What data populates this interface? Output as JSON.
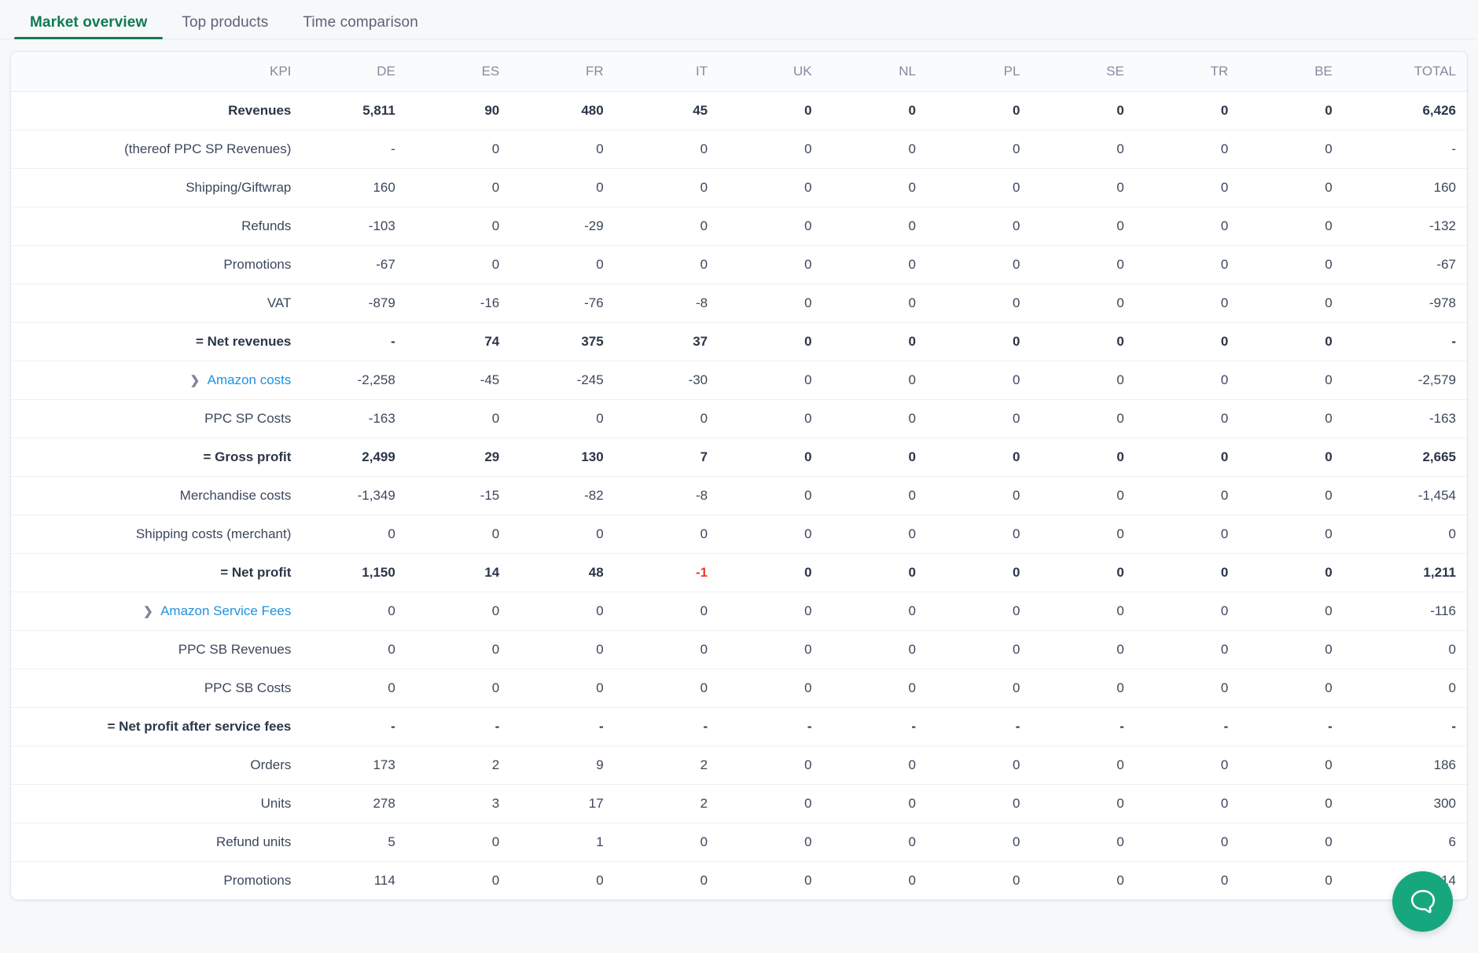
{
  "tabs": [
    {
      "label": "Market overview",
      "active": true
    },
    {
      "label": "Top products",
      "active": false
    },
    {
      "label": "Time comparison",
      "active": false
    }
  ],
  "table": {
    "columns": [
      "KPI",
      "DE",
      "ES",
      "FR",
      "IT",
      "UK",
      "NL",
      "PL",
      "SE",
      "TR",
      "BE",
      "TOTAL"
    ],
    "rows": [
      {
        "label": "Revenues",
        "bold": true,
        "expandable": false,
        "link": false,
        "values": [
          "5,811",
          "90",
          "480",
          "45",
          "0",
          "0",
          "0",
          "0",
          "0",
          "0",
          "6,426"
        ]
      },
      {
        "label": "(thereof PPC SP Revenues)",
        "bold": false,
        "expandable": false,
        "link": false,
        "values": [
          "-",
          "0",
          "0",
          "0",
          "0",
          "0",
          "0",
          "0",
          "0",
          "0",
          "-"
        ]
      },
      {
        "label": "Shipping/Giftwrap",
        "bold": false,
        "expandable": false,
        "link": false,
        "values": [
          "160",
          "0",
          "0",
          "0",
          "0",
          "0",
          "0",
          "0",
          "0",
          "0",
          "160"
        ]
      },
      {
        "label": "Refunds",
        "bold": false,
        "expandable": false,
        "link": false,
        "values": [
          "-103",
          "0",
          "-29",
          "0",
          "0",
          "0",
          "0",
          "0",
          "0",
          "0",
          "-132"
        ]
      },
      {
        "label": "Promotions",
        "bold": false,
        "expandable": false,
        "link": false,
        "values": [
          "-67",
          "0",
          "0",
          "0",
          "0",
          "0",
          "0",
          "0",
          "0",
          "0",
          "-67"
        ]
      },
      {
        "label": "VAT",
        "bold": false,
        "expandable": false,
        "link": false,
        "values": [
          "-879",
          "-16",
          "-76",
          "-8",
          "0",
          "0",
          "0",
          "0",
          "0",
          "0",
          "-978"
        ]
      },
      {
        "label": "= Net revenues",
        "bold": true,
        "expandable": false,
        "link": false,
        "values": [
          "-",
          "74",
          "375",
          "37",
          "0",
          "0",
          "0",
          "0",
          "0",
          "0",
          "-"
        ]
      },
      {
        "label": "Amazon costs",
        "bold": false,
        "expandable": true,
        "link": true,
        "values": [
          "-2,258",
          "-45",
          "-245",
          "-30",
          "0",
          "0",
          "0",
          "0",
          "0",
          "0",
          "-2,579"
        ]
      },
      {
        "label": "PPC SP Costs",
        "bold": false,
        "expandable": false,
        "link": false,
        "values": [
          "-163",
          "0",
          "0",
          "0",
          "0",
          "0",
          "0",
          "0",
          "0",
          "0",
          "-163"
        ]
      },
      {
        "label": "= Gross profit",
        "bold": true,
        "expandable": false,
        "link": false,
        "values": [
          "2,499",
          "29",
          "130",
          "7",
          "0",
          "0",
          "0",
          "0",
          "0",
          "0",
          "2,665"
        ]
      },
      {
        "label": "Merchandise costs",
        "bold": false,
        "expandable": false,
        "link": false,
        "values": [
          "-1,349",
          "-15",
          "-82",
          "-8",
          "0",
          "0",
          "0",
          "0",
          "0",
          "0",
          "-1,454"
        ]
      },
      {
        "label": "Shipping costs (merchant)",
        "bold": false,
        "expandable": false,
        "link": false,
        "values": [
          "0",
          "0",
          "0",
          "0",
          "0",
          "0",
          "0",
          "0",
          "0",
          "0",
          "0"
        ]
      },
      {
        "label": "= Net profit",
        "bold": true,
        "expandable": false,
        "link": false,
        "values": [
          "1,150",
          "14",
          "48",
          "-1",
          "0",
          "0",
          "0",
          "0",
          "0",
          "0",
          "1,211"
        ]
      },
      {
        "label": "Amazon Service Fees",
        "bold": false,
        "expandable": true,
        "link": true,
        "values": [
          "0",
          "0",
          "0",
          "0",
          "0",
          "0",
          "0",
          "0",
          "0",
          "0",
          "-116"
        ]
      },
      {
        "label": "PPC SB Revenues",
        "bold": false,
        "expandable": false,
        "link": false,
        "values": [
          "0",
          "0",
          "0",
          "0",
          "0",
          "0",
          "0",
          "0",
          "0",
          "0",
          "0"
        ]
      },
      {
        "label": "PPC SB Costs",
        "bold": false,
        "expandable": false,
        "link": false,
        "values": [
          "0",
          "0",
          "0",
          "0",
          "0",
          "0",
          "0",
          "0",
          "0",
          "0",
          "0"
        ]
      },
      {
        "label": "= Net profit after service fees",
        "bold": true,
        "expandable": false,
        "link": false,
        "values": [
          "-",
          "-",
          "-",
          "-",
          "-",
          "-",
          "-",
          "-",
          "-",
          "-",
          "-"
        ]
      },
      {
        "label": "Orders",
        "bold": false,
        "expandable": false,
        "link": false,
        "values": [
          "173",
          "2",
          "9",
          "2",
          "0",
          "0",
          "0",
          "0",
          "0",
          "0",
          "186"
        ]
      },
      {
        "label": "Units",
        "bold": false,
        "expandable": false,
        "link": false,
        "values": [
          "278",
          "3",
          "17",
          "2",
          "0",
          "0",
          "0",
          "0",
          "0",
          "0",
          "300"
        ]
      },
      {
        "label": "Refund units",
        "bold": false,
        "expandable": false,
        "link": false,
        "values": [
          "5",
          "0",
          "1",
          "0",
          "0",
          "0",
          "0",
          "0",
          "0",
          "0",
          "6"
        ]
      },
      {
        "label": "Promotions",
        "bold": false,
        "expandable": false,
        "link": false,
        "values": [
          "114",
          "0",
          "0",
          "0",
          "0",
          "0",
          "0",
          "0",
          "0",
          "0",
          "114"
        ]
      }
    ]
  },
  "help": {
    "icon": "chat-bubble-icon",
    "color": "#17a77e"
  },
  "colors": {
    "accent": "#117a52",
    "link": "#1f93e0",
    "negative": "#f0392b",
    "text": "#3c475c",
    "header_text": "#828c9e",
    "page_bg": "#f7f8fa"
  },
  "chevron_glyph": "❯"
}
